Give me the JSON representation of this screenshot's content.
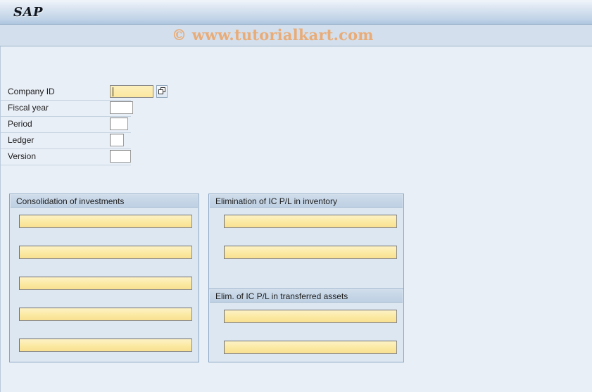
{
  "window": {
    "logo": "SAP",
    "watermark": "© www.tutorialkart.com"
  },
  "header_form": {
    "rows": [
      {
        "label": "Company ID",
        "value": "",
        "field_width": 62,
        "focused": true,
        "has_search_help": true
      },
      {
        "label": "Fiscal year",
        "value": "",
        "field_width": 33,
        "focused": false,
        "has_search_help": false
      },
      {
        "label": "Period",
        "value": "",
        "field_width": 26,
        "focused": false,
        "has_search_help": false
      },
      {
        "label": "Ledger",
        "value": "",
        "field_width": 20,
        "focused": false,
        "has_search_help": false
      },
      {
        "label": "Version",
        "value": "",
        "field_width": 30,
        "focused": false,
        "has_search_help": false
      }
    ]
  },
  "groups": [
    {
      "title": "Consolidation of investments",
      "fields": [
        {
          "value": ""
        },
        {
          "value": ""
        },
        {
          "value": ""
        },
        {
          "value": ""
        },
        {
          "value": ""
        }
      ]
    },
    {
      "title": "Elimination of IC P/L in inventory",
      "fields": [
        {
          "value": ""
        },
        {
          "value": ""
        }
      ]
    },
    {
      "title": "Elim. of IC P/L in transferred assets",
      "fields": [
        {
          "value": ""
        },
        {
          "value": ""
        }
      ]
    }
  ],
  "icons": {
    "search_help": "search-help-icon"
  },
  "colors": {
    "accent": "#aec6e0",
    "field_required": "#fbe9a2",
    "watermark": "#e9ac77",
    "background": "#e9eff7",
    "groupbox_bg": "#dde7f1"
  }
}
